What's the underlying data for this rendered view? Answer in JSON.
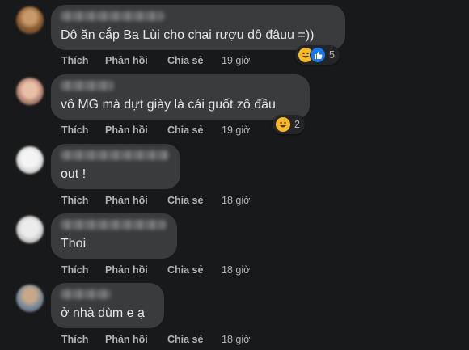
{
  "colors": {
    "background": "#18191a",
    "bubble": "#3a3b3c",
    "text": "#e4e6eb",
    "muted": "#b0b3b8",
    "like_blue": "#1877f2",
    "haha_yellow": "#f7b928"
  },
  "actions": {
    "like": "Thích",
    "reply": "Phản hồi",
    "share": "Chia sẻ"
  },
  "comments": [
    {
      "text": "Dô ăn cắp Ba Lùi cho chai rượu dô đâuu =))",
      "time": "19 giờ",
      "reactions": {
        "icons": [
          "haha-icon",
          "like-icon"
        ],
        "count": "5"
      }
    },
    {
      "text": "vô MG mà dựt giày là cái guốt zô đầu",
      "time": "19 giờ",
      "reactions": {
        "icons": [
          "haha-icon"
        ],
        "count": "2"
      }
    },
    {
      "text": "out !",
      "time": "18 giờ"
    },
    {
      "text": "Thoi",
      "time": "18 giờ"
    },
    {
      "text": "ở nhà dùm e ạ",
      "time": "18 giờ"
    }
  ]
}
